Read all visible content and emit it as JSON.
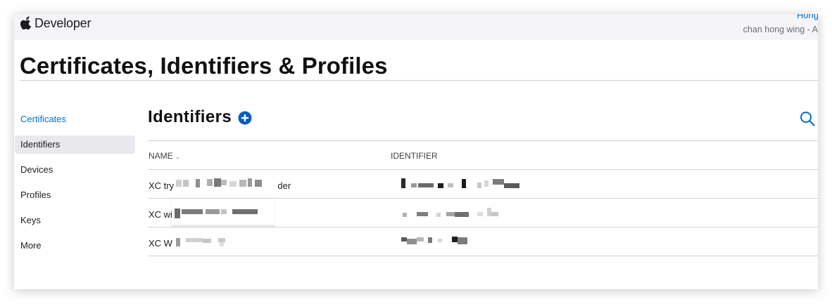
{
  "header": {
    "brand": "Developer",
    "user_name": "Hong",
    "user_team": "chan hong wing - A"
  },
  "page_title": "Certificates, Identifiers & Profiles",
  "sidebar": {
    "items": [
      {
        "label": "Certificates"
      },
      {
        "label": "Identifiers",
        "active": true
      },
      {
        "label": "Devices"
      },
      {
        "label": "Profiles"
      },
      {
        "label": "Keys"
      },
      {
        "label": "More"
      }
    ]
  },
  "section": {
    "title": "Identifiers",
    "add_icon": "plus-circle-icon",
    "search_icon": "search-icon"
  },
  "table": {
    "columns": [
      {
        "label": "NAME",
        "sort": "descending"
      },
      {
        "label": "IDENTIFIER"
      }
    ],
    "rows": [
      {
        "name_prefix": "XC try",
        "name_suffix": "der"
      },
      {
        "name_prefix": "XC wi",
        "name_suffix": ""
      },
      {
        "name_prefix": "XC W",
        "name_suffix": ""
      }
    ]
  },
  "colors": {
    "accent": "#0070c9",
    "active_nav_bg": "#e8e8ed",
    "topbar_bg": "#f5f5f7",
    "divider": "#d2d2d7"
  }
}
